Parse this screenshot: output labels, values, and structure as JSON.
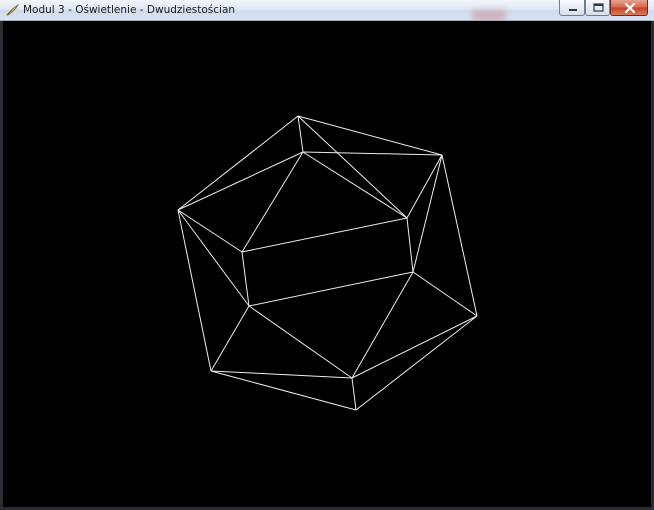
{
  "window": {
    "title": "Modul 3 - Oświetlenie - Dwudziestościan",
    "icons": {
      "app": "app-feather-icon",
      "minimize": "minimize-icon",
      "maximize": "maximize-icon",
      "close": "close-icon"
    }
  },
  "scene": {
    "object": "icosahedron-wireframe",
    "background_color": "#000000",
    "line_color": "#f4ece6"
  }
}
